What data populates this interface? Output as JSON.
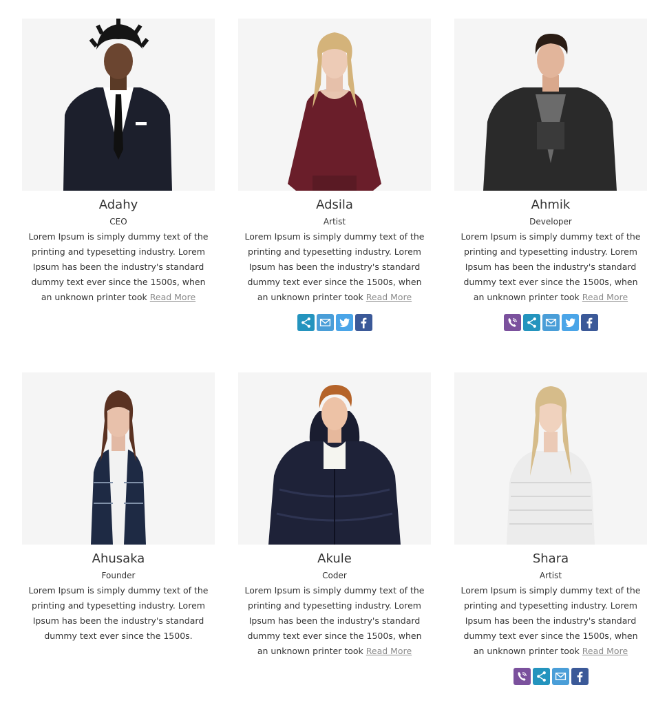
{
  "members": [
    {
      "name": "Adahy",
      "role": "CEO",
      "bio": "Lorem Ipsum is simply dummy text of the printing and typesetting industry. Lorem Ipsum has been the industry's standard dummy text ever since the 1500s, when an unknown printer took",
      "read_more": "Read More",
      "photo": "man-in-black-suit",
      "social": []
    },
    {
      "name": "Adsila",
      "role": "Artist",
      "bio": "Lorem Ipsum is simply dummy text of the printing and typesetting industry. Lorem Ipsum has been the industry's standard dummy text ever since the 1500s, when an unknown printer took",
      "read_more": "Read More",
      "photo": "woman-in-burgundy-top",
      "social": [
        "share-icon",
        "email-icon",
        "twitter-icon",
        "facebook-icon"
      ]
    },
    {
      "name": "Ahmik",
      "role": "Developer",
      "bio": "Lorem Ipsum is simply dummy text of the printing and typesetting industry. Lorem Ipsum has been the industry's standard dummy text ever since the 1500s, when an unknown printer took",
      "read_more": "Read More",
      "photo": "man-in-dark-coat",
      "social": [
        "viber-icon",
        "share-icon",
        "email-icon",
        "twitter-icon",
        "facebook-icon"
      ]
    },
    {
      "name": "Ahusaka",
      "role": "Founder",
      "bio": "Lorem Ipsum is simply dummy text of the printing and typesetting industry. Lorem Ipsum has been the industry's standard dummy text ever since the 1500s.",
      "read_more": "",
      "photo": "woman-in-patterned-jacket",
      "social": []
    },
    {
      "name": "Akule",
      "role": "Coder",
      "bio": "Lorem Ipsum is simply dummy text of the printing and typesetting industry. Lorem Ipsum has been the industry's standard dummy text ever since the 1500s, when an unknown printer took",
      "read_more": "Read More",
      "photo": "man-in-puffer-jacket",
      "social": []
    },
    {
      "name": "Shara",
      "role": "Artist",
      "bio": "Lorem Ipsum is simply dummy text of the printing and typesetting industry. Lorem Ipsum has been the industry's standard dummy text ever since the 1500s, when an unknown printer took",
      "read_more": "Read More",
      "photo": "woman-in-white-sweater",
      "social": [
        "viber-icon",
        "share-icon",
        "email-icon",
        "facebook-icon"
      ]
    }
  ],
  "colors": {
    "photo_bg": "#f5f5f5",
    "viber": "#7b519d",
    "share": "#2494be",
    "email": "#4a9ed8",
    "twitter": "#4aa5e8",
    "facebook": "#3b5998",
    "read_more": "#8a8a8a"
  }
}
